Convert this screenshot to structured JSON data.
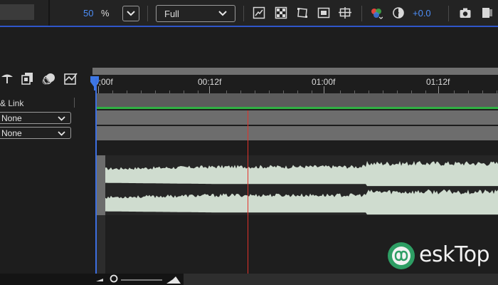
{
  "toolbar": {
    "zoom_value": "50",
    "zoom_unit": "%",
    "resolution": "Full",
    "exposure_value": "+0.0"
  },
  "timeline": {
    "ruler_labels": [
      "0;00f",
      "00:12f",
      "01:00f",
      "01:12f"
    ],
    "column_title": "& Link",
    "layers": [
      {
        "parent": "None"
      },
      {
        "parent": "None"
      }
    ]
  },
  "watermark": {
    "text": "eskTop"
  },
  "colors": {
    "accent": "#4d8ef7",
    "playhead": "#e2322a",
    "track_green": "#31b043",
    "waveform": "#cfdccf"
  }
}
